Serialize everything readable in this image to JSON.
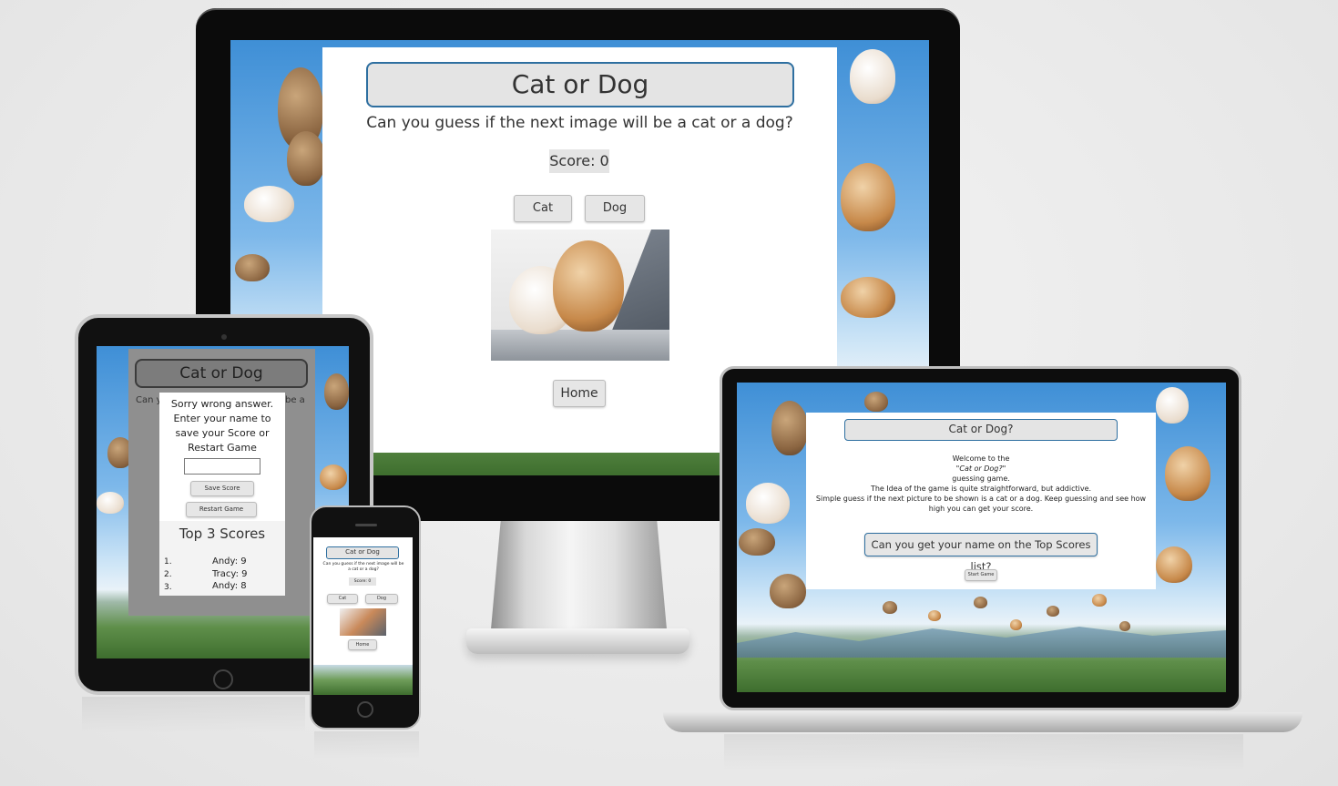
{
  "desktop": {
    "title": "Cat or Dog",
    "subtitle": "Can you guess if the next image will be a cat or a dog?",
    "score": "Score: 0",
    "cat_button": "Cat",
    "dog_button": "Dog",
    "home_button": "Home"
  },
  "tablet": {
    "title": "Cat or Dog",
    "subtitle_left": "Can y",
    "subtitle_right": "be a",
    "modal_message": "Sorry wrong answer. Enter your name to save your Score or Restart Game",
    "name_input_value": "",
    "save_button": "Save Score",
    "restart_button": "Restart Game",
    "top_scores_title": "Top 3 Scores",
    "top_scores": [
      {
        "rank": "1.",
        "entry": "Andy: 9"
      },
      {
        "rank": "2.",
        "entry": "Tracy: 9"
      },
      {
        "rank": "3.",
        "entry": "Andy: 8"
      }
    ]
  },
  "phone": {
    "title": "Cat or Dog",
    "subtitle": "Can you guess if the next image will be a cat or a dog?",
    "score": "Score: 0",
    "cat_button": "Cat",
    "dog_button": "Dog",
    "home_button": "Home"
  },
  "laptop": {
    "title": "Cat or Dog?",
    "welcome_line1": "Welcome to the",
    "welcome_line2": "\"Cat or Dog?\"",
    "welcome_line3": "guessing game.",
    "welcome_line4": "The Idea of the game is quite straightforward, but addictive.",
    "welcome_line5": "Simple guess if the next picture to be shown is a cat or a dog. Keep guessing and see how high you can get your score.",
    "cta_button": "Can you get your name on the Top Scores list?",
    "start_button": "Start Game"
  },
  "colors": {
    "title_border": "#2e6fa0",
    "button_bg": "#e6e6e6",
    "device_black": "#0b0b0b"
  }
}
